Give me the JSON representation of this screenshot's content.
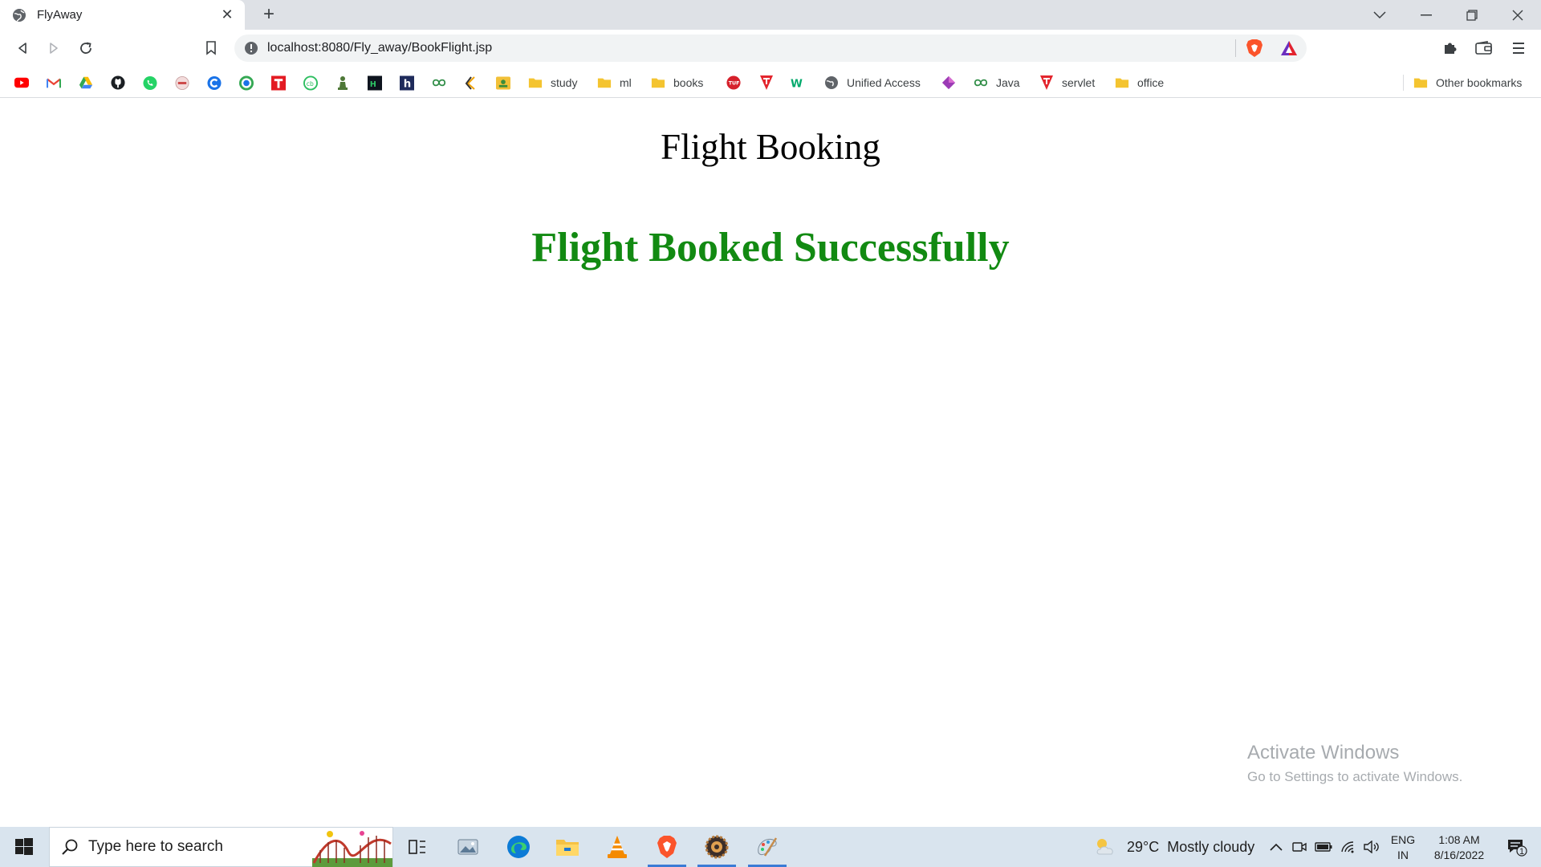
{
  "browser": {
    "tab_title": "FlyAway",
    "new_tab_label": "+",
    "url": "localhost:8080/Fly_away/BookFlight.jsp"
  },
  "bookmarks": {
    "items": [
      {
        "label": "study"
      },
      {
        "label": "ml"
      },
      {
        "label": "books"
      },
      {
        "label": "Unified Access"
      },
      {
        "label": "Java"
      },
      {
        "label": "servlet"
      },
      {
        "label": "office"
      }
    ],
    "other_label": "Other bookmarks"
  },
  "page": {
    "heading": "Flight Booking",
    "message": "Flight Booked Successfully",
    "message_color": "#128a12"
  },
  "watermark": {
    "line1": "Activate Windows",
    "line2": "Go to Settings to activate Windows."
  },
  "taskbar": {
    "search_placeholder": "Type here to search",
    "weather_temp": "29°C",
    "weather_text": "Mostly cloudy",
    "lang_top": "ENG",
    "lang_bottom": "IN",
    "time": "1:08 AM",
    "date": "8/16/2022",
    "notification_count": "1"
  }
}
